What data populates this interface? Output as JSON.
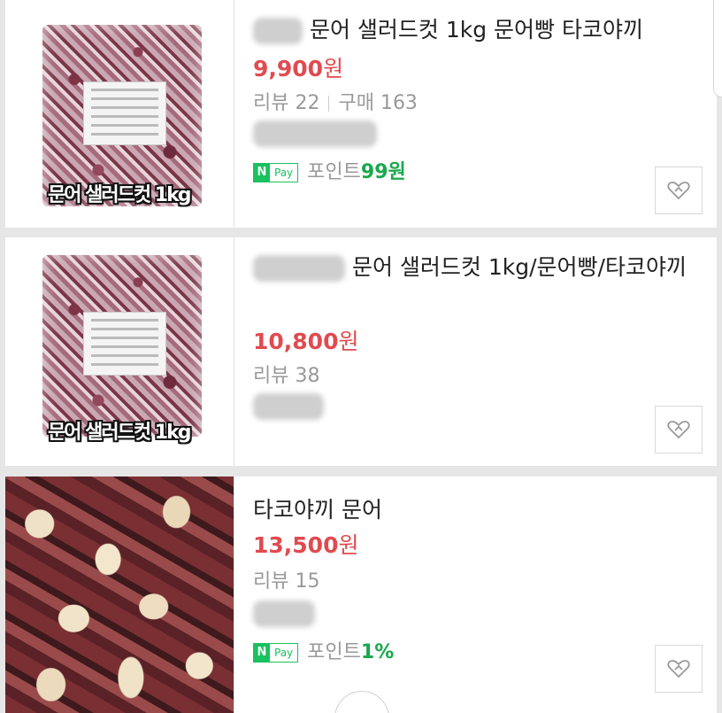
{
  "products": [
    {
      "title": "문어 샐러드컷 1kg 문어빵 타코야끼",
      "price": "9,900",
      "price_unit": "원",
      "review": "리뷰 22",
      "purchase": "구매 163",
      "npay_n": "N",
      "npay_label": "Pay",
      "points_label": "포인트",
      "points_value": "99원",
      "image_caption": "문어 샐러드컷 1kg"
    },
    {
      "title": "문어 샐러드컷 1kg/문어빵/타코야끼",
      "price": "10,800",
      "price_unit": "원",
      "review": "리뷰 38",
      "image_caption": "문어 샐러드컷 1kg"
    },
    {
      "title": "타코야끼 문어",
      "price": "13,500",
      "price_unit": "원",
      "review": "리뷰 15",
      "npay_n": "N",
      "npay_label": "Pay",
      "points_label": "포인트",
      "points_value": "1%"
    }
  ],
  "colors": {
    "price": "#e14a4f",
    "npay": "#19c15f",
    "points": "#19a84d"
  },
  "icons": {
    "wishlist": "heart-icon"
  }
}
